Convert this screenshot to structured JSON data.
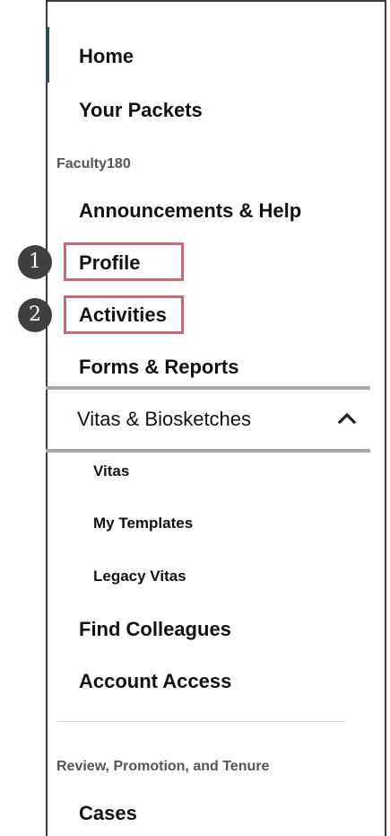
{
  "nav": {
    "home": "Home",
    "your_packets": "Your Packets",
    "section_faculty180": "Faculty180",
    "announcements": "Announcements & Help",
    "profile": "Profile",
    "activities": "Activities",
    "forms_reports": "Forms & Reports",
    "vitas_group": {
      "label": "Vitas & Biosketches",
      "icon": "chevron-up-icon",
      "expanded": true,
      "items": [
        {
          "label": "Vitas"
        },
        {
          "label": "My Templates"
        },
        {
          "label": "Legacy Vitas"
        }
      ]
    },
    "find_colleagues": "Find Colleagues",
    "account_access": "Account Access",
    "section_rpt": "Review, Promotion, and Tenure",
    "cases": "Cases"
  },
  "annotations": {
    "badge_1": "1",
    "badge_2": "2"
  },
  "colors": {
    "active_indicator": "#2f4a5c",
    "highlight_border": "#c26b73",
    "badge_fill": "#404040",
    "divider": "#a8a8a8"
  }
}
